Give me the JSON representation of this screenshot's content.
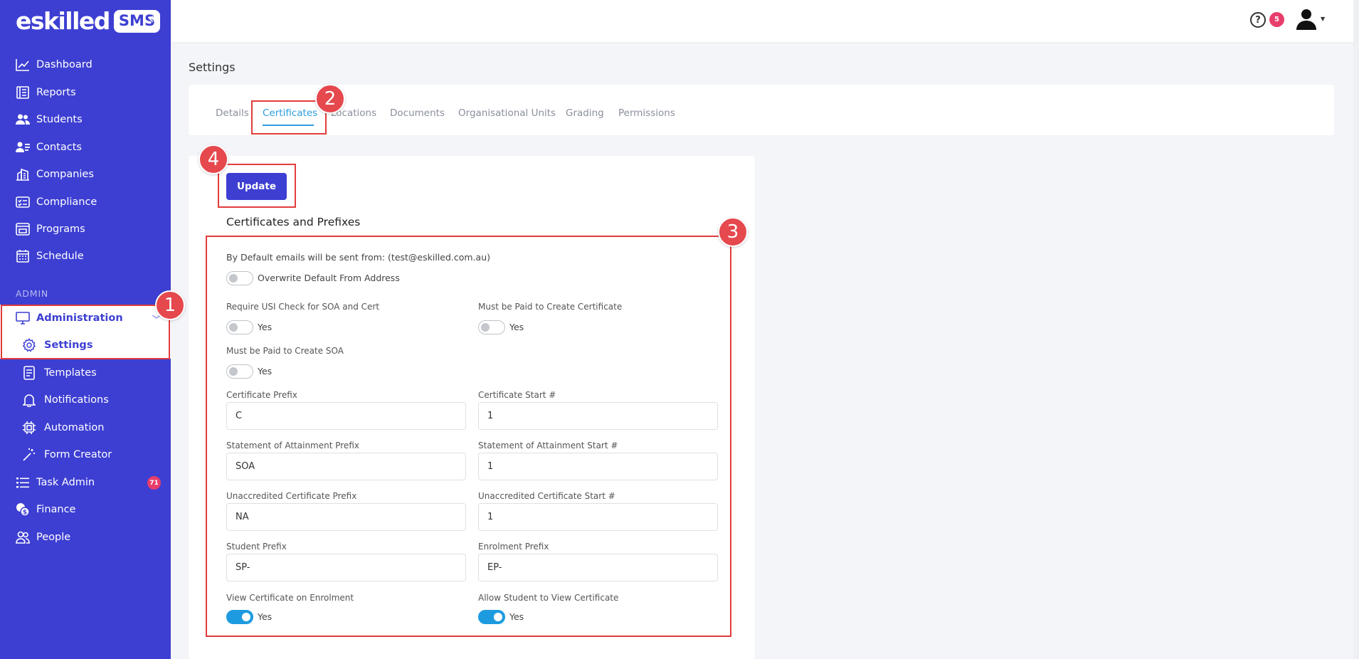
{
  "app": {
    "logo_text": "eskilled",
    "logo_badge": "SMS",
    "collapse_icon": "double-chevron-left-icon",
    "accent_color": "#3d3fd2"
  },
  "sidebar": {
    "items": [
      {
        "label": "Dashboard",
        "icon": "line-chart-icon"
      },
      {
        "label": "Reports",
        "icon": "report-icon"
      },
      {
        "label": "Students",
        "icon": "users-icon"
      },
      {
        "label": "Contacts",
        "icon": "contacts-icon"
      },
      {
        "label": "Companies",
        "icon": "building-icon"
      },
      {
        "label": "Compliance",
        "icon": "checklist-icon"
      },
      {
        "label": "Programs",
        "icon": "browser-icon"
      },
      {
        "label": "Schedule",
        "icon": "calendar-icon"
      }
    ],
    "admin_label": "ADMIN",
    "admin_items": [
      {
        "label": "Administration",
        "icon": "monitor-icon"
      },
      {
        "label": "Settings",
        "icon": "gear-icon"
      },
      {
        "label": "Templates",
        "icon": "document-icon"
      },
      {
        "label": "Notifications",
        "icon": "bell-icon"
      },
      {
        "label": "Automation",
        "icon": "chip-icon"
      },
      {
        "label": "Form Creator",
        "icon": "magic-wand-icon"
      },
      {
        "label": "Task Admin",
        "icon": "list-icon",
        "badge": "71"
      },
      {
        "label": "Finance",
        "icon": "coins-icon"
      },
      {
        "label": "People",
        "icon": "people-icon"
      }
    ]
  },
  "topbar": {
    "help_icon": "question-circle-icon",
    "help_symbol": "?",
    "notification_count": "5",
    "user_icon": "user-icon"
  },
  "page": {
    "title": "Settings",
    "tabs": [
      "Details",
      "Certificates",
      "Locations",
      "Documents",
      "Organisational Units",
      "Grading",
      "Permissions"
    ],
    "active_tab": "Certificates"
  },
  "form": {
    "update_label": "Update",
    "section_title": "Certificates and Prefixes",
    "default_email_text": "By Default emails will be sent from: (test@eskilled.com.au)",
    "overwrite_label": "Overwrite Default From Address",
    "yes": "Yes",
    "require_usi_label": "Require USI Check for SOA and Cert",
    "paid_cert_label": "Must be Paid to Create Certificate",
    "paid_soa_label": "Must be Paid to Create SOA",
    "cert_prefix_label": "Certificate Prefix",
    "cert_prefix_value": "C",
    "cert_start_label": "Certificate Start #",
    "cert_start_value": "1",
    "soa_prefix_label": "Statement of Attainment Prefix",
    "soa_prefix_value": "SOA",
    "soa_start_label": "Statement of Attainment Start #",
    "soa_start_value": "1",
    "unacc_prefix_label": "Unaccredited Certificate Prefix",
    "unacc_prefix_value": "NA",
    "unacc_start_label": "Unaccredited Certificate Start #",
    "unacc_start_value": "1",
    "student_prefix_label": "Student Prefix",
    "student_prefix_value": "SP-",
    "enrolment_prefix_label": "Enrolment Prefix",
    "enrolment_prefix_value": "EP-",
    "view_cert_label": "View Certificate on Enrolment",
    "allow_student_label": "Allow Student to View Certificate",
    "toggles": {
      "overwrite": false,
      "require_usi": false,
      "paid_cert": false,
      "paid_soa": false,
      "view_cert": true,
      "allow_student": true
    }
  },
  "annotations": {
    "markers": [
      "1",
      "2",
      "3",
      "4"
    ],
    "color": "#e23c3c"
  }
}
